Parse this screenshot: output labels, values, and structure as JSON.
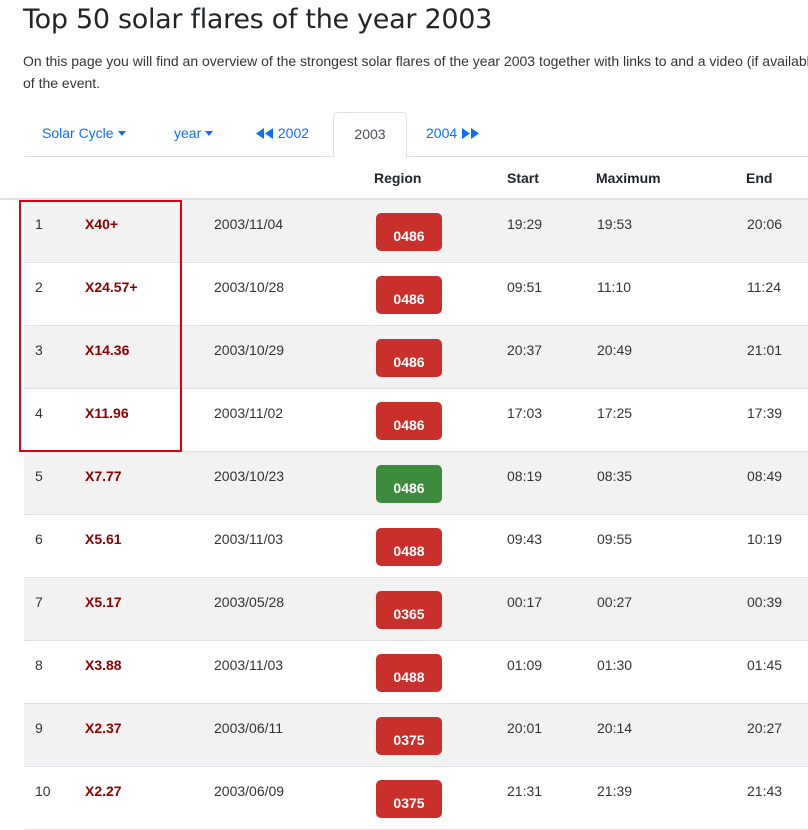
{
  "page": {
    "title": "Top 50 solar flares of the year 2003",
    "intro": "On this page you will find an overview of the strongest solar flares of the year 2003 together with links to and a video (if available) of the event."
  },
  "nav": {
    "solar_cycle": "Solar Cycle",
    "year": "year",
    "prev_year": "2002",
    "current_year": "2003",
    "next_year": "2004"
  },
  "table": {
    "headers": [
      "",
      "",
      "",
      "Region",
      "Start",
      "Maximum",
      "End"
    ],
    "rows": [
      {
        "rank": "1",
        "class": "X40+",
        "date": "2003/11/04",
        "region": "0486",
        "start": "19:29",
        "max": "19:53",
        "end": "20:06",
        "region_color": "#c9302c"
      },
      {
        "rank": "2",
        "class": "X24.57+",
        "date": "2003/10/28",
        "region": "0486",
        "start": "09:51",
        "max": "11:10",
        "end": "11:24",
        "region_color": "#c9302c"
      },
      {
        "rank": "3",
        "class": "X14.36",
        "date": "2003/10/29",
        "region": "0486",
        "start": "20:37",
        "max": "20:49",
        "end": "21:01",
        "region_color": "#c9302c"
      },
      {
        "rank": "4",
        "class": "X11.96",
        "date": "2003/11/02",
        "region": "0486",
        "start": "17:03",
        "max": "17:25",
        "end": "17:39",
        "region_color": "#c9302c"
      },
      {
        "rank": "5",
        "class": "X7.77",
        "date": "2003/10/23",
        "region": "0486",
        "start": "08:19",
        "max": "08:35",
        "end": "08:49",
        "region_color": "#3d8b3d"
      },
      {
        "rank": "6",
        "class": "X5.61",
        "date": "2003/11/03",
        "region": "0488",
        "start": "09:43",
        "max": "09:55",
        "end": "10:19",
        "region_color": "#c9302c"
      },
      {
        "rank": "7",
        "class": "X5.17",
        "date": "2003/05/28",
        "region": "0365",
        "start": "00:17",
        "max": "00:27",
        "end": "00:39",
        "region_color": "#c9302c"
      },
      {
        "rank": "8",
        "class": "X3.88",
        "date": "2003/11/03",
        "region": "0488",
        "start": "01:09",
        "max": "01:30",
        "end": "01:45",
        "region_color": "#c9302c"
      },
      {
        "rank": "9",
        "class": "X2.37",
        "date": "2003/06/11",
        "region": "0375",
        "start": "20:01",
        "max": "20:14",
        "end": "20:27",
        "region_color": "#c9302c"
      },
      {
        "rank": "10",
        "class": "X2.27",
        "date": "2003/06/09",
        "region": "0375",
        "start": "21:31",
        "max": "21:39",
        "end": "21:43",
        "region_color": "#c9302c"
      }
    ]
  },
  "colors": {
    "link": "#0d6efd",
    "flare_class": "#8b0000",
    "highlight_box": "#e0000f"
  }
}
